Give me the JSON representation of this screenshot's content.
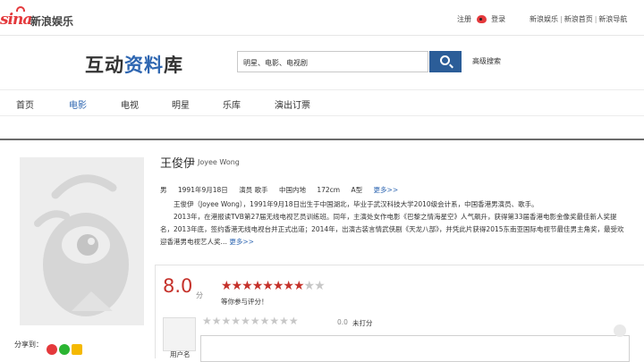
{
  "header": {
    "logo_sina": "sina",
    "logo_text": "新浪娱乐",
    "register": "注册",
    "login": "登录",
    "links": [
      "新浪娱乐",
      "新浪首页",
      "新浪导航"
    ],
    "link_separator": "|"
  },
  "brand": {
    "part1": "互动",
    "part2": "资料",
    "part3": "库"
  },
  "search": {
    "value": "明星、电影、电视剧",
    "advanced": "高级搜索"
  },
  "nav": {
    "items": [
      {
        "label": "首页"
      },
      {
        "label": "电影",
        "active": true
      },
      {
        "label": "电视"
      },
      {
        "label": "明星"
      },
      {
        "label": "乐库"
      },
      {
        "label": "演出订票"
      }
    ]
  },
  "person": {
    "name": "王俊伊",
    "name_en": "Joyee Wong",
    "gender": "男",
    "birth": "1991年9月18日",
    "occupation": "演员 歌手",
    "region": "中国内地",
    "height": "172cm",
    "blood": "A型",
    "more": "更多>>",
    "bio": [
      "王俊伊（Joyee Wong），1991年9月18日出生于中国湖北，毕业于武汉科技大学2010级会计系，中国香港男演员、歌手。",
      "2013年，在港报读TVB第27届无线电视艺员训练班。同年，主演处女作电影《巴黎之情海星空》人气飙升，获得第33届香港电影金像奖最佳新人奖提名，2013年底，签约香港无线电视台并正式出道；2014年，出演古装言情武侠剧《天龙八部》，并凭此片获得2015东南亚国际电视节最佳男主角奖，最受欢迎香港男电视艺人奖…"
    ],
    "bio_more": "更多>>"
  },
  "share": {
    "label": "分享到："
  },
  "rating": {
    "score": "8.0",
    "unit": "分",
    "stars_filled": 8,
    "stars_total": 10,
    "prompt": "等你参与评分！",
    "user_label": "用户名",
    "my_score": "0.0",
    "my_status": "未打分"
  },
  "colors": {
    "accent": "#2e66b1",
    "brand_red": "#e4393c",
    "score_red": "#c5312a",
    "search_btn": "#2b5d98"
  }
}
